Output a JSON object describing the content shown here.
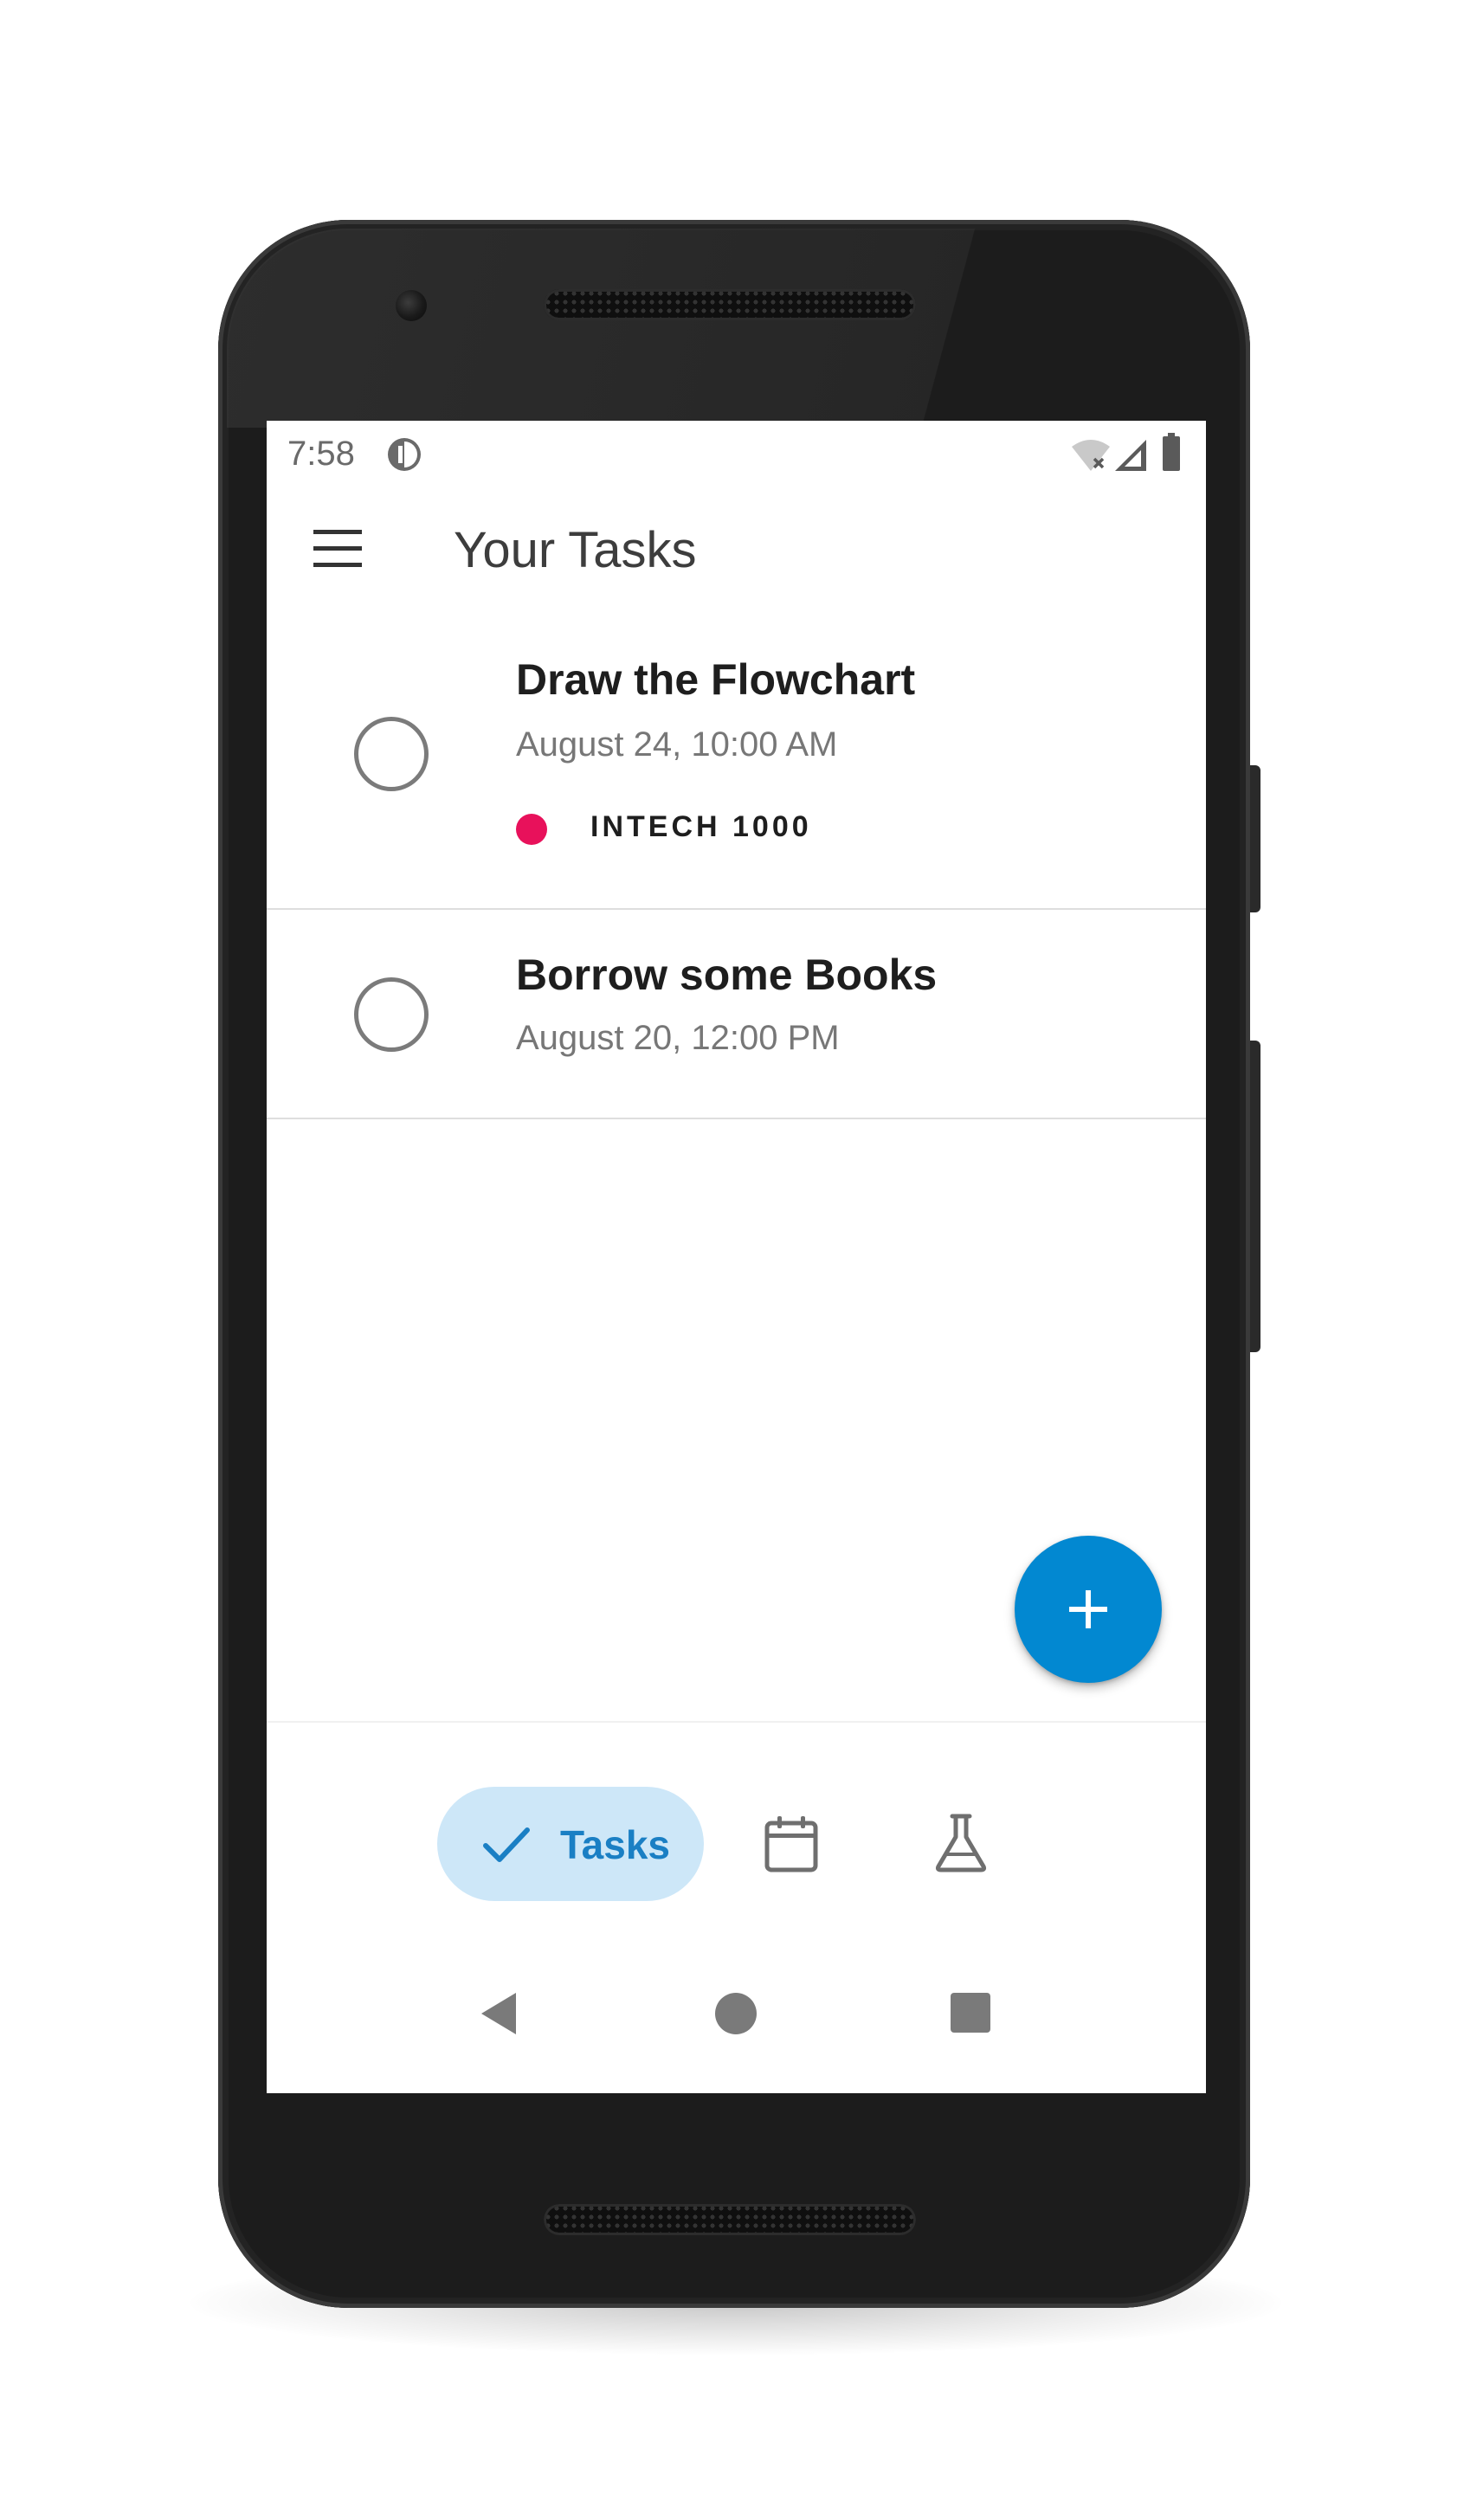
{
  "status_bar": {
    "time": "7:58",
    "app_icon": "circle-half-icon",
    "wifi_icon": "wifi-off-icon",
    "signal_icon": "cell-signal-icon",
    "battery_icon": "battery-icon"
  },
  "app_bar": {
    "menu_icon": "menu-icon",
    "title": "Your Tasks"
  },
  "tasks": [
    {
      "title": "Draw the Flowchart",
      "date": "August 24, 10:00 AM",
      "tag": {
        "label": "INTECH 1000",
        "color": "#e8115b"
      },
      "completed": false
    },
    {
      "title": "Borrow some Books",
      "date": "August 20, 12:00 PM",
      "completed": false
    }
  ],
  "fab": {
    "icon": "plus-icon",
    "color": "#0288d1"
  },
  "bottom_nav": {
    "items": [
      {
        "label": "Tasks",
        "icon": "check-icon",
        "selected": true
      },
      {
        "label": "",
        "icon": "calendar-icon",
        "selected": false
      },
      {
        "label": "",
        "icon": "flask-icon",
        "selected": false
      }
    ],
    "selected_pill_color": "#cde7f8",
    "selected_text_color": "#1a7fc4"
  },
  "system_nav": {
    "back_icon": "back-triangle-icon",
    "home_icon": "home-circle-icon",
    "recents_icon": "recents-square-icon"
  }
}
